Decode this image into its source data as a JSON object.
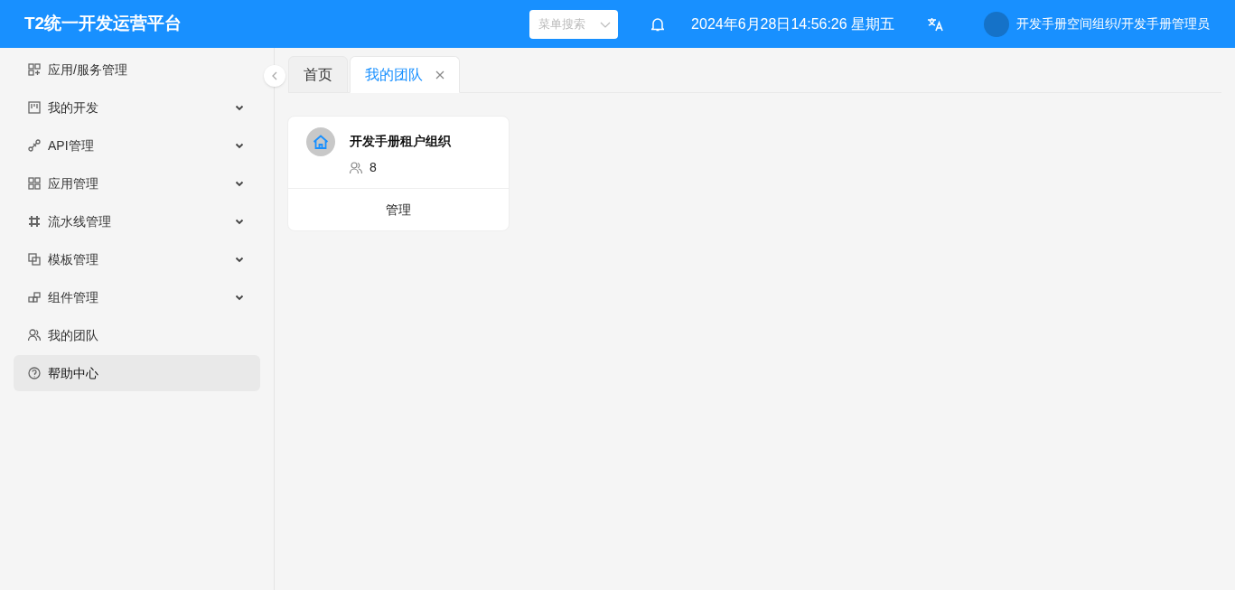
{
  "header": {
    "title": "T2统一开发运营平台",
    "menu_search": {
      "placeholder": "菜单搜索"
    },
    "datetime": "2024年6月28日14:56:26 星期五",
    "user": "开发手册空间组织/开发手册管理员"
  },
  "sidebar": {
    "items": [
      {
        "label": "应用/服务管理",
        "expandable": false,
        "selected": false
      },
      {
        "label": "我的开发",
        "expandable": true,
        "selected": false
      },
      {
        "label": "API管理",
        "expandable": true,
        "selected": false
      },
      {
        "label": "应用管理",
        "expandable": true,
        "selected": false
      },
      {
        "label": "流水线管理",
        "expandable": true,
        "selected": false
      },
      {
        "label": "模板管理",
        "expandable": true,
        "selected": false
      },
      {
        "label": "组件管理",
        "expandable": true,
        "selected": false
      },
      {
        "label": "我的团队",
        "expandable": false,
        "selected": false
      },
      {
        "label": "帮助中心",
        "expandable": false,
        "selected": true
      }
    ]
  },
  "tabs": [
    {
      "label": "首页",
      "closable": false,
      "selected": false
    },
    {
      "label": "我的团队",
      "closable": true,
      "selected": true
    }
  ],
  "teams": [
    {
      "name": "开发手册租户组织",
      "members": "8",
      "action": "管理"
    }
  ]
}
